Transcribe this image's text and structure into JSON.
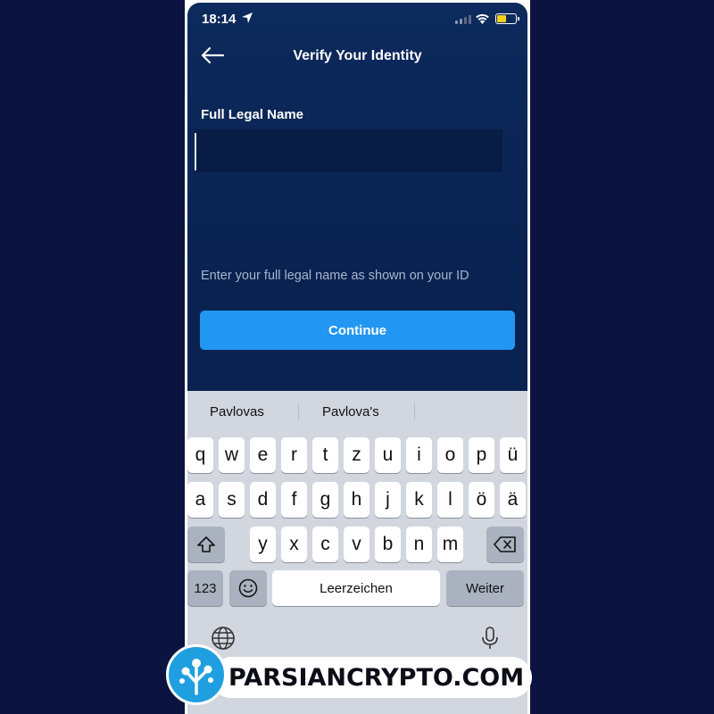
{
  "status_bar": {
    "time": "18:14",
    "battery_level": 0.55,
    "battery_color": "#f4d21a",
    "icons": [
      "location-arrow-icon",
      "cellular-signal-icon",
      "wifi-icon",
      "battery-icon"
    ]
  },
  "header": {
    "title": "Verify Your Identity",
    "back_icon": "arrow-left-icon"
  },
  "form": {
    "field_label": "Full Legal Name",
    "field_value": "",
    "helper_text": "Enter your full legal name as shown on your ID",
    "continue_label": "Continue",
    "accent_color": "#2196f3"
  },
  "keyboard": {
    "suggestions": [
      "Pavlovas",
      "Pavlova's"
    ],
    "row1": [
      "q",
      "w",
      "e",
      "r",
      "t",
      "z",
      "u",
      "i",
      "o",
      "p",
      "ü"
    ],
    "row2": [
      "a",
      "s",
      "d",
      "f",
      "g",
      "h",
      "j",
      "k",
      "l",
      "ö",
      "ä"
    ],
    "row3": [
      "y",
      "x",
      "c",
      "v",
      "b",
      "n",
      "m"
    ],
    "numbers_label": "123",
    "space_label": "Leerzeichen",
    "return_label": "Weiter",
    "icons": [
      "shift-icon",
      "backspace-icon",
      "emoji-icon",
      "globe-icon",
      "microphone-icon"
    ]
  },
  "watermark": {
    "text": "PARSIANCRYPTO.COM"
  }
}
